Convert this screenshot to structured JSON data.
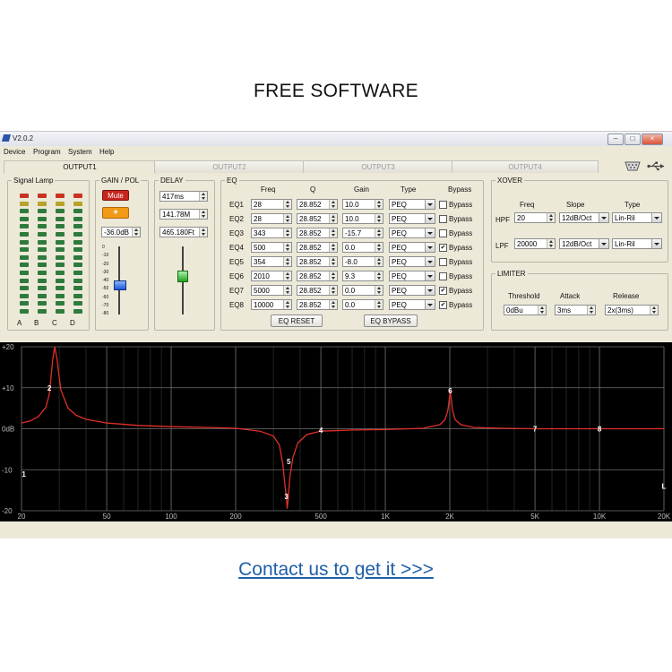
{
  "heading": "FREE SOFTWARE",
  "footer_link": "Contact us to get it >>>",
  "window": {
    "version": "V2.0.2",
    "controls": {
      "minimize": "–",
      "maximize": "□",
      "close": "×"
    }
  },
  "menu": [
    "Device",
    "Program",
    "System",
    "Help"
  ],
  "tabs": [
    "OUTPUT1",
    "OUTPUT2",
    "OUTPUT3",
    "OUTPUT4"
  ],
  "active_tab": 0,
  "connection_icons": [
    "serial-port-icon",
    "usb-icon"
  ],
  "signal_lamp": {
    "title": "Signal Lamp",
    "channels": [
      "A",
      "B",
      "C",
      "D"
    ],
    "colors": {
      "red": "#c8341f",
      "yellow": "#b9a22a",
      "green": "#2f7a3d"
    }
  },
  "gain_pol": {
    "title": "GAIN / POL",
    "mute_label": "Mute",
    "polarity_label": "+",
    "gain_value": "-36.0dB",
    "scale": [
      "0",
      "-10",
      "-20",
      "-30",
      "-40",
      "-50",
      "-60",
      "-70",
      "-80"
    ],
    "level": 0.6
  },
  "delay": {
    "title": "DELAY",
    "time": "417ms",
    "meters": "141.78M",
    "feet": "465.180Ft",
    "level": 0.45
  },
  "eq": {
    "title": "EQ",
    "headers": {
      "freq": "Freq",
      "q": "Q",
      "gain": "Gain",
      "type": "Type",
      "bypass": "Bypass"
    },
    "bands": [
      {
        "name": "EQ1",
        "freq": "28",
        "q": "28.852",
        "gain": "10.0",
        "type": "PEQ",
        "bypass_label": "Bypass",
        "bypass": false
      },
      {
        "name": "EQ2",
        "freq": "28",
        "q": "28.852",
        "gain": "10.0",
        "type": "PEQ",
        "bypass_label": "Bypass",
        "bypass": false
      },
      {
        "name": "EQ3",
        "freq": "343",
        "q": "28.852",
        "gain": "-15.7",
        "type": "PEQ",
        "bypass_label": "Bypass",
        "bypass": false
      },
      {
        "name": "EQ4",
        "freq": "500",
        "q": "28.852",
        "gain": "0.0",
        "type": "PEQ",
        "bypass_label": "Bypass",
        "bypass": true
      },
      {
        "name": "EQ5",
        "freq": "354",
        "q": "28.852",
        "gain": "-8.0",
        "type": "PEQ",
        "bypass_label": "Bypass",
        "bypass": false
      },
      {
        "name": "EQ6",
        "freq": "2010",
        "q": "28.852",
        "gain": "9.3",
        "type": "PEQ",
        "bypass_label": "Bypass",
        "bypass": false
      },
      {
        "name": "EQ7",
        "freq": "5000",
        "q": "28.852",
        "gain": "0.0",
        "type": "PEQ",
        "bypass_label": "Bypass",
        "bypass": true
      },
      {
        "name": "EQ8",
        "freq": "10000",
        "q": "28.852",
        "gain": "0.0",
        "type": "PEQ",
        "bypass_label": "Bypass",
        "bypass": true
      }
    ],
    "reset_label": "EQ RESET",
    "bypass_all_label": "EQ BYPASS"
  },
  "xover": {
    "title": "XOVER",
    "headers": {
      "freq": "Freq",
      "slope": "Slope",
      "type": "Type"
    },
    "hpf": {
      "label": "HPF",
      "freq": "20",
      "slope": "12dB/Oct",
      "type": "Lin-Ril"
    },
    "lpf": {
      "label": "LPF",
      "freq": "20000",
      "slope": "12dB/Oct",
      "type": "Lin-Ril"
    }
  },
  "limiter": {
    "title": "LIMITER",
    "headers": {
      "threshold": "Threshold",
      "attack": "Attack",
      "release": "Release"
    },
    "threshold": "0dBu",
    "attack": "3ms",
    "release": "2x(3ms)"
  },
  "chart_data": {
    "type": "line",
    "x_scale": "log",
    "xlim": [
      20,
      20000
    ],
    "ylim": [
      -20,
      20
    ],
    "x_ticks": [
      {
        "value": 20,
        "label": "20"
      },
      {
        "value": 50,
        "label": "50"
      },
      {
        "value": 100,
        "label": "100"
      },
      {
        "value": 200,
        "label": "200"
      },
      {
        "value": 500,
        "label": "500"
      },
      {
        "value": 1000,
        "label": "1K"
      },
      {
        "value": 2000,
        "label": "2K"
      },
      {
        "value": 5000,
        "label": "5K"
      },
      {
        "value": 10000,
        "label": "10K"
      },
      {
        "value": 20000,
        "label": "20K"
      }
    ],
    "y_ticks": [
      {
        "value": 20,
        "label": "+20"
      },
      {
        "value": 10,
        "label": "+10"
      },
      {
        "value": 0,
        "label": "0dB"
      },
      {
        "value": -10,
        "label": "-10"
      },
      {
        "value": -20,
        "label": "-20"
      }
    ],
    "grid": true,
    "line_color": "#e0302a",
    "curve": [
      [
        20,
        1.4
      ],
      [
        22,
        1.9
      ],
      [
        24,
        3.0
      ],
      [
        26,
        5.2
      ],
      [
        27,
        8.5
      ],
      [
        28,
        17.0
      ],
      [
        28.6,
        20.0
      ],
      [
        29.3,
        17.0
      ],
      [
        30.5,
        9.5
      ],
      [
        33,
        5.0
      ],
      [
        36,
        3.3
      ],
      [
        40,
        2.3
      ],
      [
        50,
        1.4
      ],
      [
        70,
        0.8
      ],
      [
        100,
        0.5
      ],
      [
        150,
        0.3
      ],
      [
        200,
        0.1
      ],
      [
        260,
        -0.6
      ],
      [
        300,
        -1.8
      ],
      [
        320,
        -4.0
      ],
      [
        332,
        -8.5
      ],
      [
        340,
        -14.0
      ],
      [
        345,
        -16.5
      ],
      [
        348,
        -19.5
      ],
      [
        352,
        -17.0
      ],
      [
        358,
        -12.0
      ],
      [
        370,
        -7.0
      ],
      [
        390,
        -3.5
      ],
      [
        430,
        -1.4
      ],
      [
        500,
        -0.6
      ],
      [
        700,
        -0.3
      ],
      [
        1000,
        -0.2
      ],
      [
        1500,
        0.1
      ],
      [
        1800,
        1.0
      ],
      [
        1900,
        2.2
      ],
      [
        1960,
        4.5
      ],
      [
        2010,
        9.3
      ],
      [
        2060,
        4.5
      ],
      [
        2120,
        2.2
      ],
      [
        2250,
        1.0
      ],
      [
        2600,
        0.3
      ],
      [
        3500,
        0.1
      ],
      [
        5000,
        0.0
      ],
      [
        10000,
        0.0
      ],
      [
        20000,
        0.0
      ]
    ],
    "markers": [
      {
        "label": "1",
        "x": 20.5,
        "y": -11.0
      },
      {
        "label": "2",
        "x": 27.0,
        "y": 10.0
      },
      {
        "label": "3",
        "x": 345,
        "y": -16.5
      },
      {
        "label": "4",
        "x": 500,
        "y": -0.3
      },
      {
        "label": "5",
        "x": 354,
        "y": -8.0
      },
      {
        "label": "6",
        "x": 2010,
        "y": 9.3
      },
      {
        "label": "7",
        "x": 5000,
        "y": 0.0
      },
      {
        "label": "8",
        "x": 10000,
        "y": 0.0
      },
      {
        "label": "L",
        "x": 20000,
        "y": -14.0
      }
    ]
  }
}
